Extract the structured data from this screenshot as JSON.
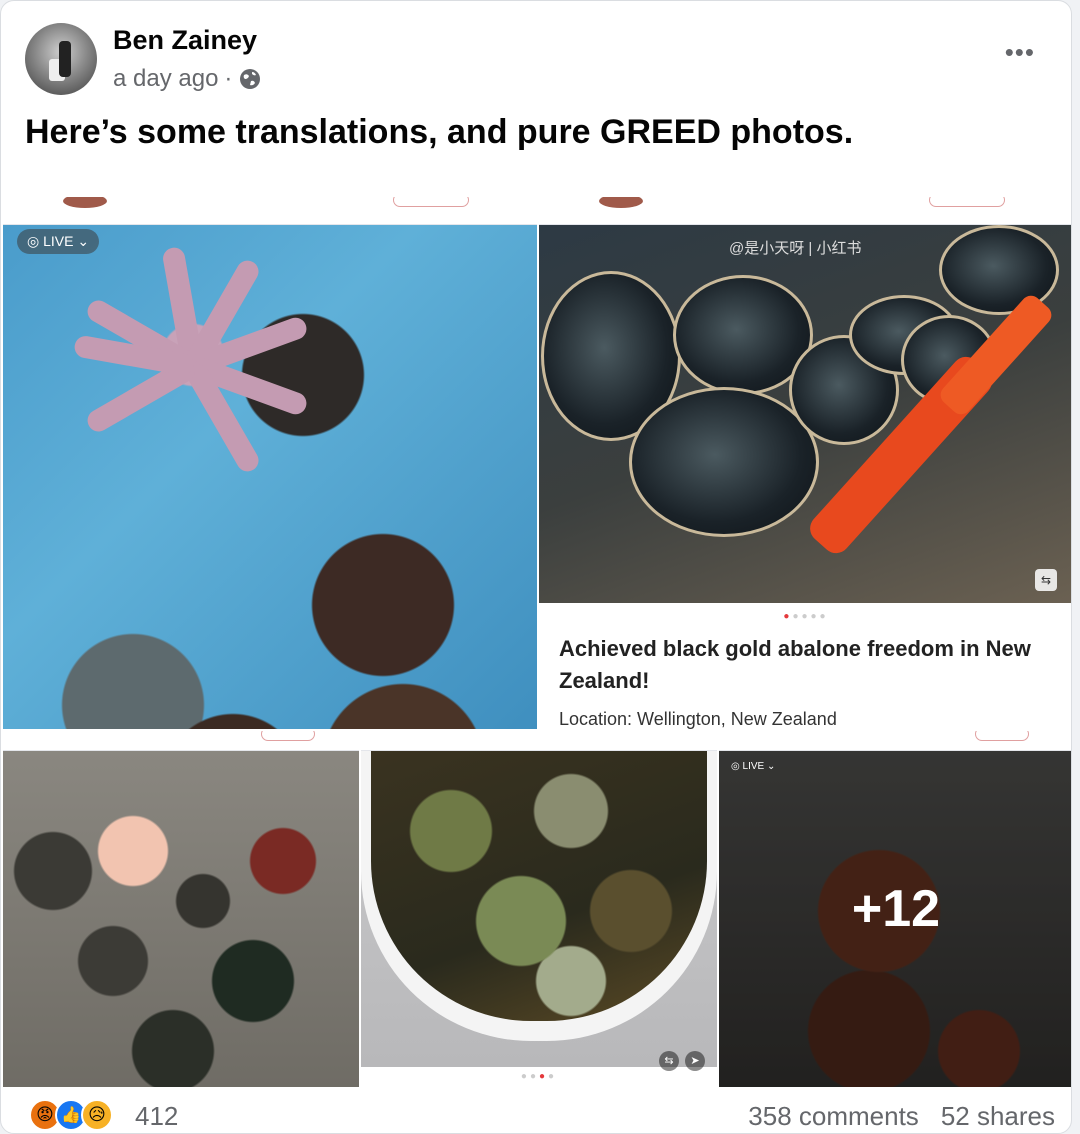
{
  "post": {
    "author": "Ben Zainey",
    "time": "a day ago",
    "separator": "·",
    "text": "Here’s some translations, and pure GREED photos."
  },
  "icons": {
    "more": "more-options-icon",
    "globe": "globe-icon",
    "translate": "translate-icon"
  },
  "photos": {
    "p1": {
      "live_label": "◎ LIVE ⌄"
    },
    "p2": {
      "watermark": "@是小天呀 | 小红书",
      "title": "Achieved black gold abalone freedom in New Zealand!",
      "location": "Location: Wellington, New Zealand"
    },
    "p5": {
      "live_label": "◎ LIVE ⌄",
      "more_count": "+12"
    }
  },
  "reactions": {
    "count": "412",
    "comments": "358 comments",
    "shares": "52 shares"
  },
  "colors": {
    "like": "#1877f2",
    "angry": "#e9710f",
    "sad": "#f7b125"
  }
}
